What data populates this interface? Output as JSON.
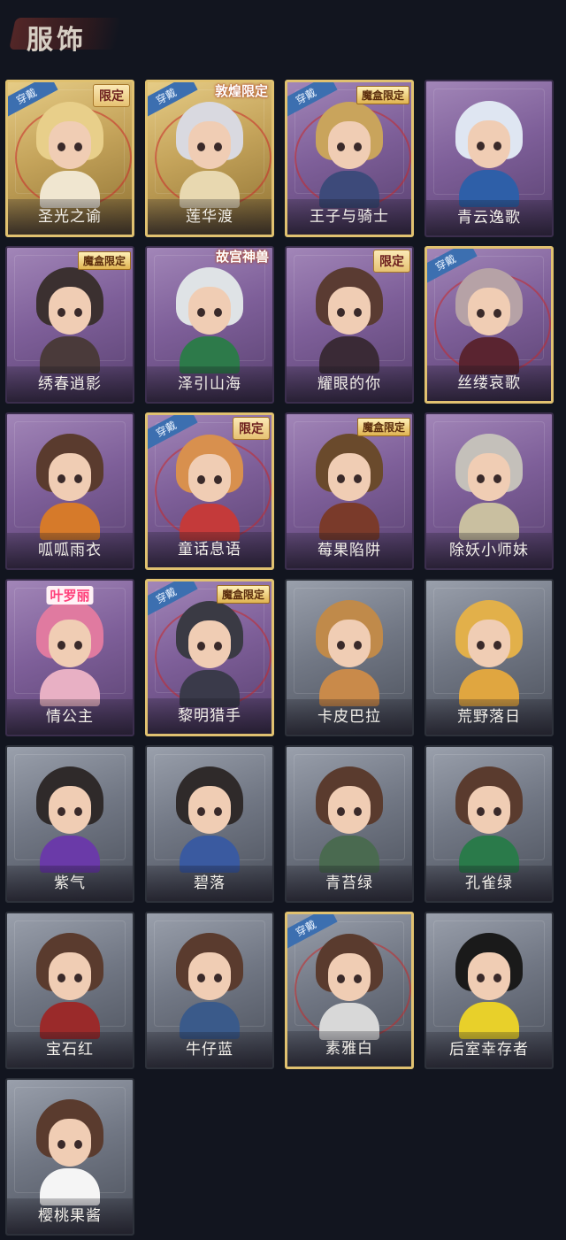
{
  "header": {
    "title": "服饰"
  },
  "tags": {
    "equipped": "穿戴",
    "limited": "限定",
    "magic_box": "魔盒限定",
    "dunhuang": "敦煌限定",
    "palace": "故宫神兽",
    "collab": "叶罗丽"
  },
  "costumes": [
    {
      "name": "圣光之谕",
      "frame": "gold",
      "equipped": true,
      "tag": "limited"
    },
    {
      "name": "莲华渡",
      "frame": "gold",
      "equipped": true,
      "tag": "dunhuang"
    },
    {
      "name": "王子与骑士",
      "frame": "purple",
      "equipped": true,
      "tag": "magic_box"
    },
    {
      "name": "青云逸歌",
      "frame": "purple",
      "equipped": false,
      "tag": null
    },
    {
      "name": "绣春逍影",
      "frame": "purple",
      "equipped": false,
      "tag": "magic_box"
    },
    {
      "name": "泽引山海",
      "frame": "purple",
      "equipped": false,
      "tag": "palace"
    },
    {
      "name": "耀眼的你",
      "frame": "purple",
      "equipped": false,
      "tag": "limited"
    },
    {
      "name": "丝缕哀歌",
      "frame": "purple",
      "equipped": true,
      "tag": null
    },
    {
      "name": "呱呱雨衣",
      "frame": "purple",
      "equipped": false,
      "tag": null
    },
    {
      "name": "童话息语",
      "frame": "purple",
      "equipped": true,
      "tag": "limited"
    },
    {
      "name": "莓果陷阱",
      "frame": "purple",
      "equipped": false,
      "tag": "magic_box"
    },
    {
      "name": "除妖小师妹",
      "frame": "purple",
      "equipped": false,
      "tag": null
    },
    {
      "name": "情公主",
      "frame": "purple",
      "equipped": false,
      "tag": "collab"
    },
    {
      "name": "黎明猎手",
      "frame": "purple",
      "equipped": true,
      "tag": "magic_box"
    },
    {
      "name": "卡皮巴拉",
      "frame": "grey",
      "equipped": false,
      "tag": null
    },
    {
      "name": "荒野落日",
      "frame": "grey",
      "equipped": false,
      "tag": null
    },
    {
      "name": "紫气",
      "frame": "grey",
      "equipped": false,
      "tag": null
    },
    {
      "name": "碧落",
      "frame": "grey",
      "equipped": false,
      "tag": null
    },
    {
      "name": "青苔绿",
      "frame": "grey",
      "equipped": false,
      "tag": null
    },
    {
      "name": "孔雀绿",
      "frame": "grey",
      "equipped": false,
      "tag": null
    },
    {
      "name": "宝石红",
      "frame": "grey",
      "equipped": false,
      "tag": null
    },
    {
      "name": "牛仔蓝",
      "frame": "grey",
      "equipped": false,
      "tag": null
    },
    {
      "name": "素雅白",
      "frame": "grey",
      "equipped": true,
      "tag": null
    },
    {
      "name": "后室幸存者",
      "frame": "grey",
      "equipped": false,
      "tag": null
    },
    {
      "name": "樱桃果酱",
      "frame": "grey",
      "equipped": false,
      "tag": null
    }
  ],
  "colors": {
    "background": "#12151f",
    "purple_frame": "#7e5f99",
    "grey_frame": "#717784",
    "gold_frame": "#c4a35a",
    "equipped_badge": "#3c6fb0"
  }
}
